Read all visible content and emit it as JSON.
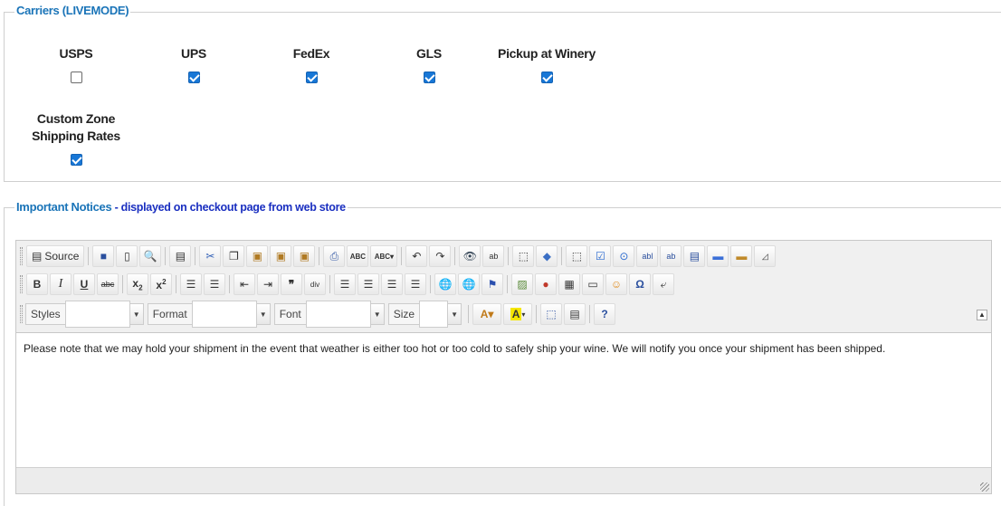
{
  "carriers_section": {
    "legend": "Carriers (LIVEMODE)",
    "items": [
      {
        "label": "USPS",
        "checked": false
      },
      {
        "label": "UPS",
        "checked": true
      },
      {
        "label": "FedEx",
        "checked": true
      },
      {
        "label": "GLS",
        "checked": true
      },
      {
        "label": "Pickup at Winery",
        "checked": true
      }
    ],
    "custom_zone": {
      "label_line1": "Custom Zone",
      "label_line2": "Shipping Rates",
      "checked": true
    }
  },
  "notices_section": {
    "legend": "Important Notices",
    "legend_sub": " - displayed on checkout page from web store"
  },
  "editor": {
    "source_label": "Source",
    "styles_label": "Styles",
    "format_label": "Format",
    "font_label": "Font",
    "size_label": "Size",
    "content": "Please note that we may hold your shipment in the event that weather is either too hot or too cold to safely ship your wine. We will notify you once your shipment has been shipped."
  },
  "colors": {
    "legend_blue": "#1a74b8",
    "sub_blue": "#1a2fc0",
    "checkbox_blue": "#1877d6"
  }
}
